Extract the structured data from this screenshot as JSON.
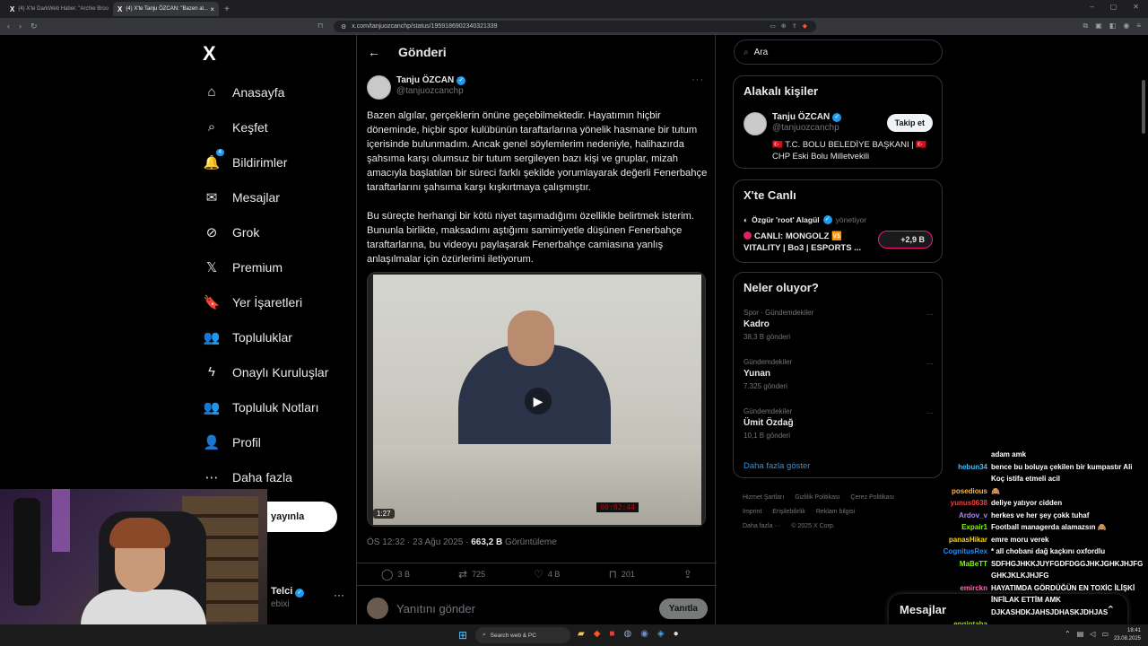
{
  "browser": {
    "tabs": [
      {
        "title": "(4) X'te DarkWeb Haber: \"Archie Broo",
        "active": false
      },
      {
        "title": "(4) X'te Tanju ÖZCAN: \"Bazen al...",
        "active": true
      }
    ],
    "url": "x.com/tanjuozcanchp/status/1959186902340321339"
  },
  "sidebar": {
    "logo": "X",
    "items": [
      {
        "label": "Anasayfa",
        "icon": "⌂"
      },
      {
        "label": "Keşfet",
        "icon": "⌕"
      },
      {
        "label": "Bildirimler",
        "icon": "🔔",
        "badge": "4"
      },
      {
        "label": "Mesajlar",
        "icon": "✉"
      },
      {
        "label": "Grok",
        "icon": "⊘"
      },
      {
        "label": "Premium",
        "icon": "𝕏"
      },
      {
        "label": "Yer İşaretleri",
        "icon": "🔖"
      },
      {
        "label": "Topluluklar",
        "icon": "👥"
      },
      {
        "label": "Onaylı Kuruluşlar",
        "icon": "ϟ"
      },
      {
        "label": "Topluluk Notları",
        "icon": "👥"
      },
      {
        "label": "Profil",
        "icon": "👤"
      },
      {
        "label": "Daha fazla",
        "icon": "⋯"
      }
    ],
    "post_button": "yayınla",
    "profile_name": "Telci",
    "profile_handle": "ebixi"
  },
  "main": {
    "header_title": "Gönderi",
    "author_name": "Tanju ÖZCAN",
    "author_handle": "@tanjuozcanchp",
    "paragraph1": "Bazen algılar, gerçeklerin önüne geçebilmektedir. Hayatımın hiçbir döneminde, hiçbir spor kulübünün taraftarlarına yönelik hasmane bir tutum içerisinde bulunmadım. Ancak genel söylemlerim nedeniyle, halihazırda şahsıma karşı olumsuz bir tutum sergileyen bazı kişi ve gruplar, mizah amacıyla başlatılan bir süreci farklı şekilde yorumlayarak değerli Fenerbahçe taraftarlarını şahsıma karşı kışkırtmaya çalışmıştır.",
    "paragraph2": "Bu süreçte herhangi bir kötü niyet taşımadığımı özellikle belirtmek isterim. Bununla birlikte, maksadımı aştığımı samimiyetle düşünen Fenerbahçe taraftarlarına, bu videoyu paylaşarak Fenerbahçe camiasına yanlış anlaşılmalar için özürlerimi iletiyorum.",
    "video_duration": "1:27",
    "video_clock": "00:02:44",
    "time": "ÖS 12:32 · 23 Ağu 2025 · ",
    "views": "663,2 B",
    "views_label": " Görüntüleme",
    "stats": {
      "replies": "3 B",
      "reposts": "725",
      "likes": "4 B",
      "bookmarks": "201"
    },
    "reply_placeholder": "Yanıtını gönder",
    "reply_button": "Yanıtla"
  },
  "right": {
    "search_placeholder": "Ara",
    "related_title": "Alakalı kişiler",
    "related_name": "Tanju ÖZCAN",
    "related_handle": "@tanjuozcanchp",
    "related_bio": "🇹🇷 T.C. BOLU BELEDİYE BAŞKANI | 🇹🇷 CHP Eski Bolu Milletvekili",
    "follow_button": "Takip et",
    "live_title": "X'te Canlı",
    "live_host": "Özgür 'root' Alagül",
    "live_role": "yönetiyor",
    "live_stream": "CANLI: MONGOLZ 🆚 VITALITY | Bo3 | ESPORTS ...",
    "live_count": "+2,9 B",
    "trends_title": "Neler oluyor?",
    "trends": [
      {
        "category": "Spor · Gündemdekiler",
        "name": "Kadro",
        "count": "38,3 B gönderi"
      },
      {
        "category": "Gündemdekiler",
        "name": "Yunan",
        "count": "7.325 gönderi"
      },
      {
        "category": "Gündemdekiler",
        "name": "Ümit Özdağ",
        "count": "10,1 B gönderi"
      }
    ],
    "show_more": "Daha fazla göster",
    "footer": [
      "Hizmet Şartları",
      "Gizlilik Politikası",
      "Çerez Politikası",
      "Imprint",
      "Erişilebilirlik",
      "Reklam bilgisi",
      "Daha fazla ···",
      "© 2025 X Corp."
    ]
  },
  "messages_dock": "Mesajlar",
  "chat": [
    {
      "user": "",
      "color": "#ffffff",
      "msg": "adam amk"
    },
    {
      "user": "hebun34",
      "color": "#3fc0ff",
      "msg": "bence bu boluya çekilen bir kumpastır Ali Koç istifa etmeli acil"
    },
    {
      "user": "posedious",
      "color": "#ffb347",
      "msg": "🙈"
    },
    {
      "user": "yunus0638",
      "color": "#ff3b3b",
      "msg": "deliye yatıyor cidden"
    },
    {
      "user": "Ardov_v",
      "color": "#b084ff",
      "msg": "herkes ve her şey çokk tuhaf"
    },
    {
      "user": "Expair1",
      "color": "#7cfc00",
      "msg": "Football managerda alamazsın 🙈"
    },
    {
      "user": "panasHikar",
      "color": "#ffd700",
      "msg": "emre moru verek"
    },
    {
      "user": "CognitusRex",
      "color": "#1e90ff",
      "msg": "* all chobani dağ kaçkını oxfordlu"
    },
    {
      "user": "MaBeTT",
      "color": "#7cfc00",
      "msg": "SDFHGJHKKJUYFGDFDGGJHKJGHKJHJFG GHKJKLKJHJFG"
    },
    {
      "user": "emirckn",
      "color": "#ff69b4",
      "msg": "HAYATIMDA GÖRDÜĞÜN EN TOXİC İLİŞKİ İNFİLAK ETTİM AMK DJKASHDKJAHSJDHASKJDHJAS"
    },
    {
      "user": "engintaha",
      "color": "#9acd32",
      "msg": ""
    }
  ],
  "taskbar": {
    "search": "Search web & PC",
    "time": "18:41",
    "date": "23.08.2025"
  }
}
